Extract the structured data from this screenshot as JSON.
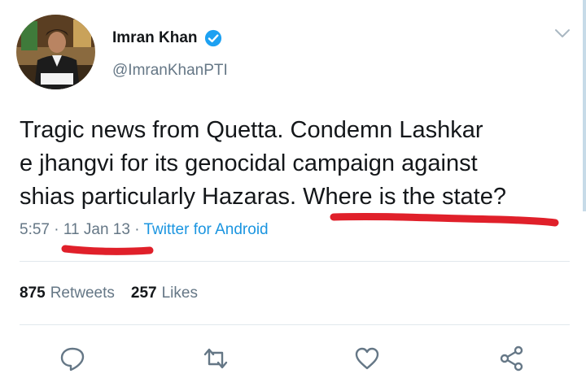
{
  "user": {
    "name": "Imran Khan",
    "handle": "@ImranKhanPTI",
    "verified": true
  },
  "tweet": {
    "lines": [
      "Tragic news from Quetta. Condemn Lashkar",
      "e jhangvi for its genocidal campaign against",
      "shias particularly Hazaras. Where is the state?"
    ],
    "time": "5:57",
    "date": "11 Jan 13",
    "separator": "·",
    "source": "Twitter for Android"
  },
  "stats": {
    "retweets_count": "875",
    "retweets_label": "Retweets",
    "likes_count": "257",
    "likes_label": "Likes"
  },
  "icons": {
    "reply": "reply-icon",
    "retweet": "retweet-icon",
    "like": "heart-icon",
    "share": "share-icon",
    "verified": "verified-badge-icon",
    "menu": "chevron-down-icon"
  },
  "colors": {
    "text": "#14171a",
    "secondary": "#657786",
    "link": "#1b95e0",
    "verified": "#1da1f2",
    "annotation": "#e0202a"
  }
}
